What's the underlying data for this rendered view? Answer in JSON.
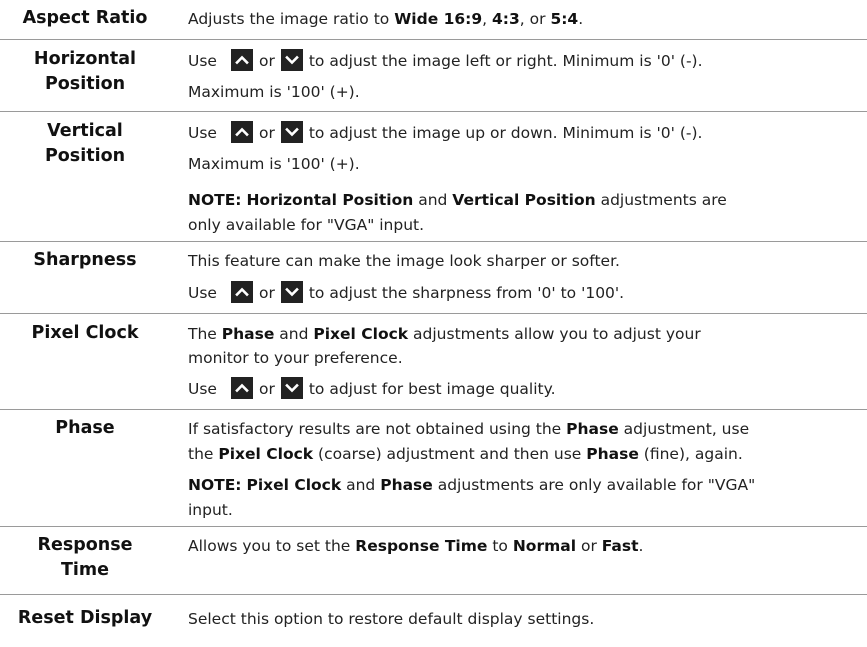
{
  "rows": {
    "aspect": {
      "label": "Aspect Ratio",
      "t1": "Adjusts the image ratio to ",
      "b1": "Wide 16:9",
      "t2": ", ",
      "b2": "4:3",
      "t3": ", or ",
      "b3": "5:4",
      "t4": "."
    },
    "hpos": {
      "label1": "Horizontal",
      "label2": "Position",
      "use": "Use",
      "or": "or",
      "rest": "to adjust the image left or right. Minimum is '0' (-).",
      "line2": "Maximum is '100' (+)."
    },
    "vpos": {
      "label1": "Vertical",
      "label2": "Position",
      "use": "Use",
      "or": "or",
      "rest": "to adjust the image up or down. Minimum is '0' (-).",
      "line2": "Maximum is '100' (+).",
      "note_label": "NOTE:",
      "note_b1": "Horizontal Position",
      "note_t1": " and ",
      "note_b2": "Vertical Position",
      "note_t2": " adjustments are",
      "note_line2": "only available for \"VGA\" input."
    },
    "sharp": {
      "label": "Sharpness",
      "line1": "This feature can make the image look sharper or softer.",
      "use": "Use",
      "or": "or",
      "rest": "to adjust the sharpness from '0' to '100'."
    },
    "pclock": {
      "label": "Pixel Clock",
      "t1": "The ",
      "b1": "Phase",
      "t2": " and ",
      "b2": "Pixel Clock",
      "t3": " adjustments allow you to adjust your",
      "line2": "monitor to your preference.",
      "use": "Use",
      "or": "or",
      "rest": "to adjust for best image quality."
    },
    "phase": {
      "label": "Phase",
      "t1": "If satisfactory results are not obtained using the ",
      "b1": "Phase",
      "t2": " adjustment, use",
      "t3": "the ",
      "b2": "Pixel Clock",
      "t4": " (coarse) adjustment and then use ",
      "b3": "Phase",
      "t5": " (fine), again.",
      "note_label": "NOTE:",
      "note_b1": "Pixel Clock",
      "note_t1": " and ",
      "note_b2": "Phase",
      "note_t2": " adjustments are only available for \"VGA\"",
      "note_line2": "input."
    },
    "resp": {
      "label1": "Response",
      "label2": "Time",
      "t1": "Allows you to set the ",
      "b1": "Response Time",
      "t2": " to ",
      "b2": "Normal",
      "t3": " or ",
      "b3": "Fast",
      "t4": "."
    },
    "reset": {
      "label": "Reset Display",
      "line1": "Select this option to restore default display settings."
    }
  },
  "icons": {
    "up": "chevron-up-icon",
    "down": "chevron-down-icon"
  },
  "colors": {
    "button_bg": "#222222",
    "button_fg": "#ffffff",
    "separator": "#9a9a9a"
  }
}
